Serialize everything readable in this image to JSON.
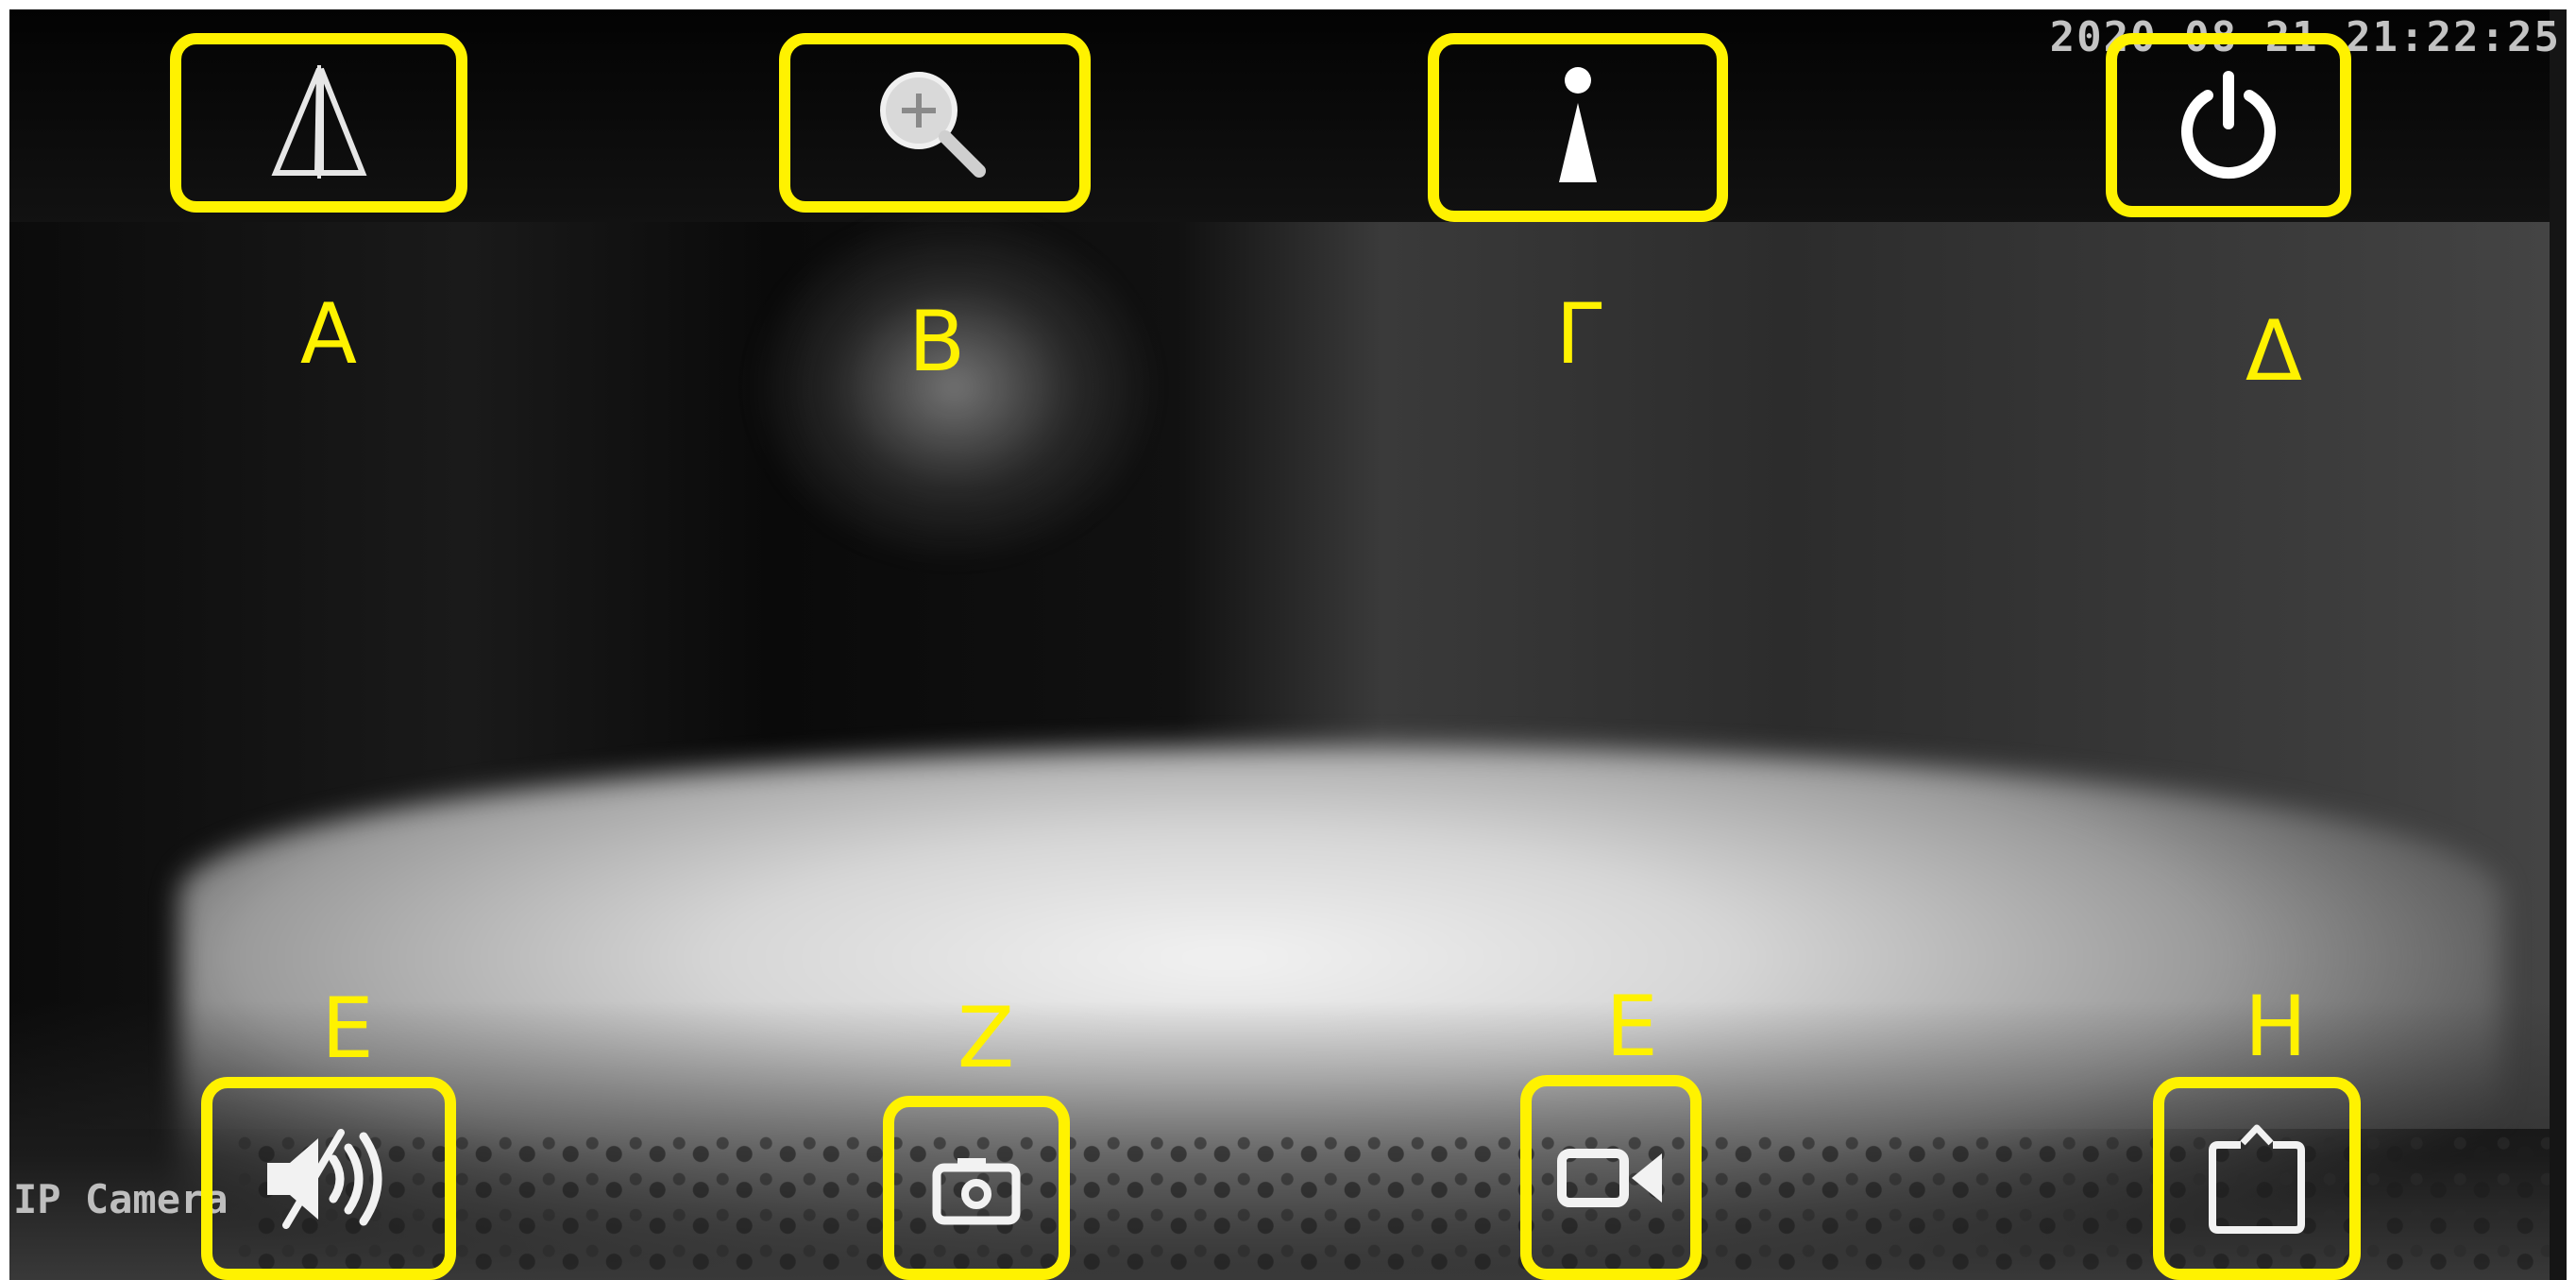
{
  "overlay": {
    "timestamp": "2020-08-21 21:22:25",
    "camera_name": "IP Camera"
  },
  "top_controls": [
    {
      "label": "A",
      "icon": "mirror-flip-icon"
    },
    {
      "label": "B",
      "icon": "zoom-in-icon"
    },
    {
      "label": "Γ",
      "icon": "info-icon"
    },
    {
      "label": "Δ",
      "icon": "power-icon"
    }
  ],
  "bottom_controls": [
    {
      "label": "E",
      "icon": "speaker-muted-icon"
    },
    {
      "label": "Z",
      "icon": "camera-icon"
    },
    {
      "label": "E",
      "icon": "video-record-icon"
    },
    {
      "label": "H",
      "icon": "share-icon"
    }
  ],
  "colors": {
    "highlight": "#fff200",
    "icon": "#ffffff"
  }
}
